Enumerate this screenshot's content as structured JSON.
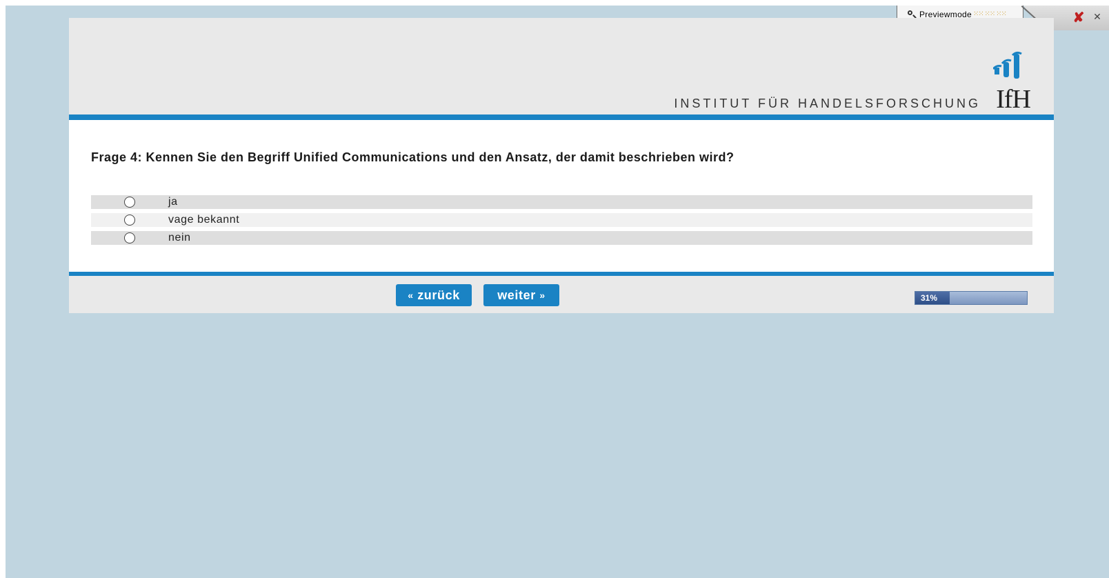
{
  "preview": {
    "label": "Previewmode",
    "dots": "⁙⁙ ⁙⁙ ⁙⁙"
  },
  "branding": {
    "institute_name": "INSTITUT FÜR HANDELSFORSCHUNG",
    "logo_abbr": "IfH"
  },
  "question": {
    "text": "Frage 4: Kennen Sie den Begriff Unified Communications und den Ansatz, der damit beschrieben wird?",
    "options": [
      {
        "label": "ja",
        "selected": false
      },
      {
        "label": "vage bekannt",
        "selected": false
      },
      {
        "label": "nein",
        "selected": false
      }
    ]
  },
  "navigation": {
    "back_label": "zurück",
    "next_label": "weiter",
    "back_arrows": "«",
    "next_arrows": "»"
  },
  "progress": {
    "label": "31%",
    "value": 0.31
  },
  "colors": {
    "accent": "#1a83c4",
    "page_background": "#c0d5e0",
    "header_background": "#e9e9e9"
  }
}
